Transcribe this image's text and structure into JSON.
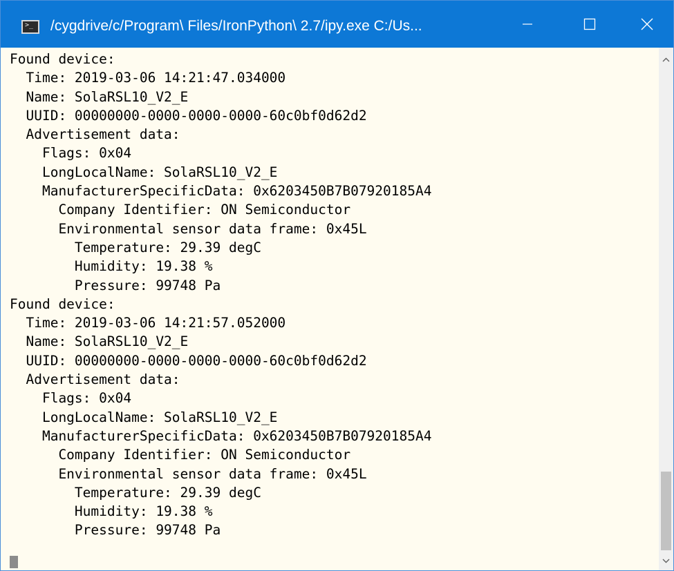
{
  "window": {
    "title": "/cygdrive/c/Program\\ Files/IronPython\\ 2.7/ipy.exe  C:/Us...",
    "icon": "console-app-icon",
    "icon_glyph": ">_",
    "controls": {
      "minimize": "minimize-icon",
      "maximize": "maximize-icon",
      "close": "close-icon"
    }
  },
  "console": {
    "background": "#fffcf0",
    "lines": [
      "Found device:",
      "  Time: 2019-03-06 14:21:47.034000",
      "  Name: SolaRSL10_V2_E",
      "  UUID: 00000000-0000-0000-0000-60c0bf0d62d2",
      "  Advertisement data:",
      "    Flags: 0x04",
      "    LongLocalName: SolaRSL10_V2_E",
      "    ManufacturerSpecificData: 0x6203450B7B07920185A4",
      "      Company Identifier: ON Semiconductor",
      "      Environmental sensor data frame: 0x45L",
      "        Temperature: 29.39 degC",
      "        Humidity: 19.38 %",
      "        Pressure: 99748 Pa",
      "Found device:",
      "  Time: 2019-03-06 14:21:57.052000",
      "  Name: SolaRSL10_V2_E",
      "  UUID: 00000000-0000-0000-0000-60c0bf0d62d2",
      "  Advertisement data:",
      "    Flags: 0x04",
      "    LongLocalName: SolaRSL10_V2_E",
      "    ManufacturerSpecificData: 0x6203450B7B07920185A4",
      "      Company Identifier: ON Semiconductor",
      "      Environmental sensor data frame: 0x45L",
      "        Temperature: 29.39 degC",
      "        Humidity: 19.38 %",
      "        Pressure: 99748 Pa"
    ]
  },
  "scrollbar": {
    "up_icon": "scroll-up-arrow-icon",
    "down_icon": "scroll-down-arrow-icon",
    "position": 0.96
  },
  "colors": {
    "titlebar": "#0d78d6",
    "title_text": "#ffffff",
    "console_text": "#000000"
  }
}
